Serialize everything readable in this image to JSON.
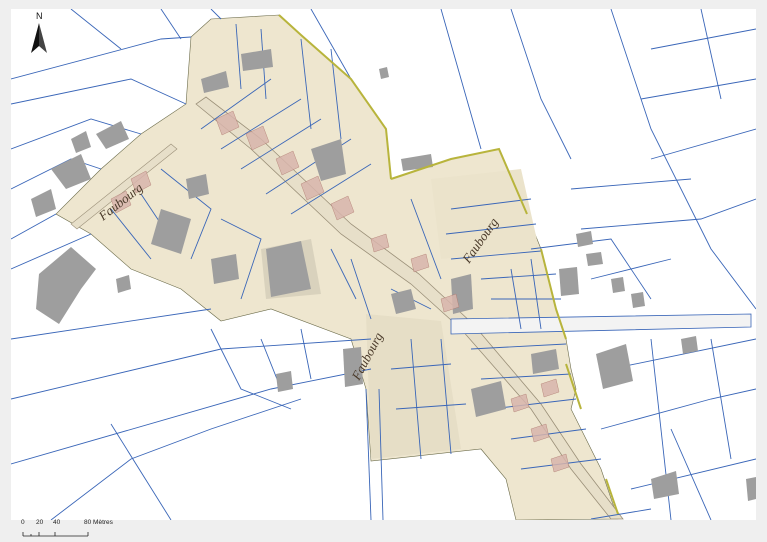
{
  "map": {
    "north_label": "N",
    "scale_ticks": [
      "0",
      "20",
      "40",
      "80 Mètres"
    ],
    "street_labels": [
      "Faubourg",
      "Faubourg",
      "Faubourg"
    ],
    "colors": {
      "parcel_line": "#3a66b8",
      "old_plan_fill": "#eee6cf",
      "building_fill": "#9e9e9e",
      "old_plan_building": "#c9a8a0",
      "boundary_highlight": "#b8b43c",
      "road_fill": "#e7dfc9"
    }
  }
}
